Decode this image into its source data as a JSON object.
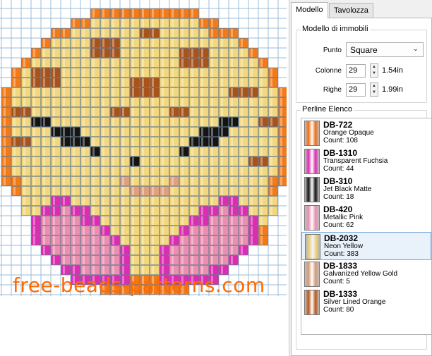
{
  "pattern": {
    "cols": 29,
    "rows": 29,
    "legend": {
      "O": "#f47a18",
      "Y": "#f2d77f",
      "B": "#a8531b",
      "K": "#141414",
      "P": "#ea8fb0",
      "F": "#dc2cb2",
      "G": "#e0a07e",
      ".": "#ffffff"
    },
    "grid": [
      ".........OOOOOOOOOOO.........",
      ".......OOYYYYYYYYYYYOO.......",
      ".....OOYYYYYYYBBYYYYYOOO.....",
      "....OYYYYBBBYYYYYYYYYYYYO....",
      "...OYYYYYBBBYYYYYYBBBYYYYO...",
      "..OYYYYYYYYYYYYYYYBBBYYYYYO..",
      ".OYBBBYYYYYYYYYYYYYYYYYYYYYO.",
      ".OYBBBYYYYYYYBBBYYYYYYYYYYYO.",
      "OYYYYYYYYYYYYBBBYYYYYYYBBBYYO",
      "OYYYYYYYYYYYYYYYYYYYYYYYYYYYO",
      "OBBYYYYYYYYBBYYYYBBYYYYYYYYYO",
      "OYYKKYYYYYYYYYYYYYYYYYKKYYBBO",
      "OYYYYKKKYYYYYYYYYYYYKKKYYYYYO",
      "OBBYYYKKKYYYYYYYYYYKKKYYYYYYO",
      "OYYYYYYYYKYYYYYYYYKYYYYYYYYYO",
      "OYYYYYYYYYYYYKYYYYYYYYYYYBBYO",
      "OYYYYYYYYYYYYYYYYYYYYYYYYYYYO",
      "OOYYYYYYYYYYGYYYYGYYYYYYYYYOO",
      ".OYYYYYYYYYYYGGGGYYYYYYYYYYO.",
      "..YYYFFYYYYYYYYYYYYYYYFFYYYY.",
      "..YYFFPFFYYYYYYYYYYYFFPFFYYY.",
      "...FPPPPFFYYYYYYYYYFFPPPPFY..",
      "...FPPPPPPFYYYYYYYFPPPPPPFO..",
      "...FPPPPPPPFYYYYYFPPPPPPPFO..",
      "....FPPPPPPPFYYYFPPPPPPPF....",
      ".....FPPPPPPFYYYFPPPPPPF.....",
      "......FFPPPPFYYYFPPPPFF......",
      ".......FFFFFFOOOFFFFFF.......",
      "..........OOOOOOOOO........."
    ]
  },
  "watermark": "free-beads-patterns.com",
  "tabs": [
    {
      "label": "Modello",
      "active": true
    },
    {
      "label": "Tavolozza",
      "active": false
    }
  ],
  "model_settings": {
    "title": "Modello di immobili",
    "stitch_label": "Punto",
    "stitch_value": "Square",
    "columns_label": "Colonne",
    "columns_value": "29",
    "columns_size": "1.54in",
    "rows_label": "Righe",
    "rows_value": "29",
    "rows_size": "1.99in"
  },
  "bead_list": {
    "title": "Perline Elenco",
    "items": [
      {
        "code": "DB-722",
        "name": "Orange Opaque",
        "count": "Count: 108",
        "color": "#f26b12",
        "selected": false
      },
      {
        "code": "DB-1310",
        "name": "Transparent Fuchsia",
        "count": "Count: 44",
        "color": "#dc2cb2",
        "selected": false
      },
      {
        "code": "DB-310",
        "name": "Jet Black Matte",
        "count": "Count: 18",
        "color": "#111111",
        "selected": false
      },
      {
        "code": "DB-420",
        "name": "Metallic Pink",
        "count": "Count: 62",
        "color": "#e68fb0",
        "selected": false
      },
      {
        "code": "DB-2032",
        "name": "Neon Yellow",
        "count": "Count: 383",
        "color": "#eecf7a",
        "selected": true
      },
      {
        "code": "DB-1833",
        "name": "Galvanized Yellow Gold",
        "count": "Count: 5",
        "color": "#d59a78",
        "selected": false
      },
      {
        "code": "DB-1333",
        "name": "Silver Lined Orange",
        "count": "Count: 80",
        "color": "#b5561a",
        "selected": false
      }
    ]
  }
}
